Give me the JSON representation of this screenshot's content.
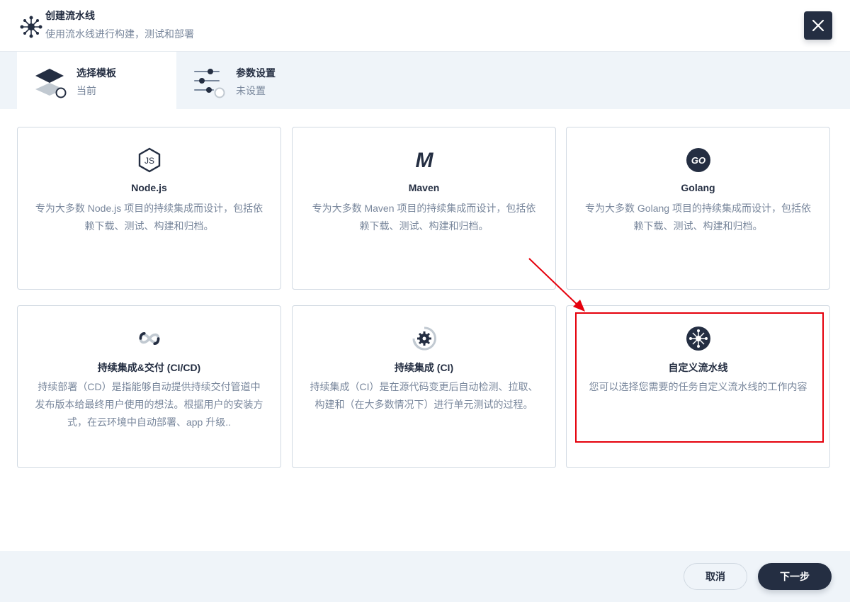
{
  "header": {
    "title": "创建流水线",
    "subtitle": "使用流水线进行构建，测试和部署"
  },
  "steps": [
    {
      "label": "选择模板",
      "state": "当前"
    },
    {
      "label": "参数设置",
      "state": "未设置"
    }
  ],
  "templates": [
    {
      "icon": "nodejs-icon",
      "title": "Node.js",
      "description": "专为大多数 Node.js 项目的持续集成而设计，包括依赖下载、测试、构建和归档。"
    },
    {
      "icon": "maven-icon",
      "title": "Maven",
      "description": "专为大多数 Maven 项目的持续集成而设计，包括依赖下载、测试、构建和归档。"
    },
    {
      "icon": "golang-icon",
      "title": "Golang",
      "description": "专为大多数 Golang 项目的持续集成而设计，包括依赖下载、测试、构建和归档。"
    },
    {
      "icon": "cicd-infinity-icon",
      "title": "持续集成&交付 (CI/CD)",
      "description": "持续部署（CD）是指能够自动提供持续交付管道中发布版本给最终用户使用的想法。根据用户的安装方式，在云环境中自动部署、app 升级.."
    },
    {
      "icon": "ci-gear-icon",
      "title": "持续集成 (CI)",
      "description": "持续集成（CI）是在源代码变更后自动检测、拉取、构建和（在大多数情况下）进行单元测试的过程。"
    },
    {
      "icon": "custom-pipeline-icon",
      "title": "自定义流水线",
      "description": "您可以选择您需要的任务自定义流水线的工作内容"
    }
  ],
  "footer": {
    "cancel_label": "取消",
    "next_label": "下一步"
  },
  "colors": {
    "primary_dark": "#242e42",
    "muted_text": "#79879c",
    "background_light": "#eff4f9",
    "annotation_red": "#e5000c"
  }
}
